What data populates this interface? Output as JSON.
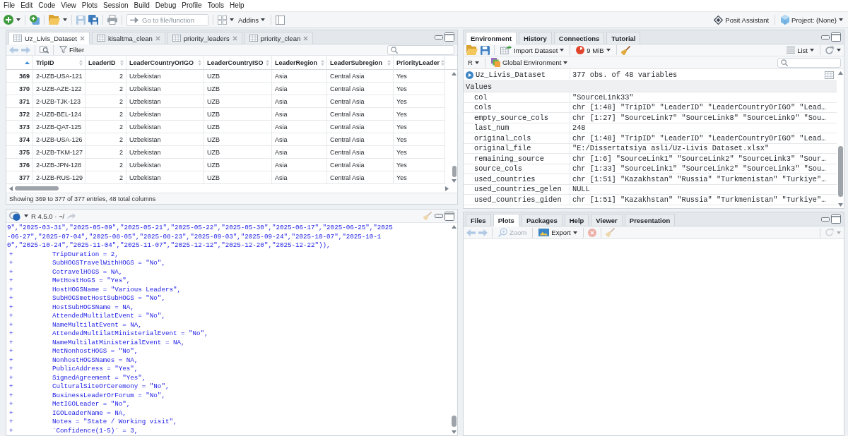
{
  "menu_bar": [
    "File",
    "Edit",
    "Code",
    "View",
    "Plots",
    "Session",
    "Build",
    "Debug",
    "Profile",
    "Tools",
    "Help"
  ],
  "toolbar": {
    "actions": [
      {
        "kind": "new_file",
        "disabled": false
      },
      {
        "kind": "new_project",
        "disabled": false
      },
      {
        "kind": "open",
        "disabled": false
      },
      {
        "kind": "save",
        "disabled": true
      },
      {
        "kind": "save_all",
        "disabled": false
      },
      {
        "kind": "print",
        "disabled": false
      }
    ],
    "goto": {
      "placeholder": "Go to file/function"
    },
    "tools": [
      {
        "kind": "layout",
        "disabled": false
      },
      {
        "kind": "addins",
        "label": "Addins",
        "disabled": false
      },
      {
        "kind": "panel",
        "disabled": false
      }
    ],
    "assistant": "Posit Assistant",
    "project": "Project: (None)"
  },
  "source_pane": {
    "tabs": [
      {
        "label": "Uz_Livis_Dataset",
        "selected": true
      },
      {
        "label": "kisaltma_clean",
        "selected": false
      },
      {
        "label": "priority_leaders",
        "selected": false
      },
      {
        "label": "priority_clean",
        "selected": false
      }
    ],
    "actions": [
      {
        "kind": "back",
        "disabled": true
      },
      {
        "kind": "forward",
        "disabled": true
      },
      {
        "kind": "popout",
        "disabled": false
      },
      {
        "kind": "filter",
        "label": "Filter",
        "disabled": false
      }
    ],
    "table": {
      "index_sorted": true,
      "columns": [
        {
          "label": "TripID",
          "kind": "text"
        },
        {
          "label": "LeaderID",
          "kind": "numeric"
        },
        {
          "label": "LeaderCountryOrIGO",
          "kind": "text"
        },
        {
          "label": "LeaderCountryISO",
          "kind": "text"
        },
        {
          "label": "LeaderRegion",
          "kind": "text"
        },
        {
          "label": "LeaderSubregion",
          "kind": "text"
        },
        {
          "label": "PriorityLeader",
          "kind": "text"
        }
      ],
      "rows": [
        {
          "index": "369",
          "cells": [
            "2-UZB-USA-121",
            "2",
            "Uzbekistan",
            "UZB",
            "Asia",
            "Central Asia",
            "Yes"
          ]
        },
        {
          "index": "370",
          "cells": [
            "2-UZB-AZE-122",
            "2",
            "Uzbekistan",
            "UZB",
            "Asia",
            "Central Asia",
            "Yes"
          ]
        },
        {
          "index": "371",
          "cells": [
            "2-UZB-TJK-123",
            "2",
            "Uzbekistan",
            "UZB",
            "Asia",
            "Central Asia",
            "Yes"
          ]
        },
        {
          "index": "372",
          "cells": [
            "2-UZB-BEL-124",
            "2",
            "Uzbekistan",
            "UZB",
            "Asia",
            "Central Asia",
            "Yes"
          ]
        },
        {
          "index": "373",
          "cells": [
            "2-UZB-QAT-125",
            "2",
            "Uzbekistan",
            "UZB",
            "Asia",
            "Central Asia",
            "Yes"
          ]
        },
        {
          "index": "374",
          "cells": [
            "2-UZB-USA-126",
            "2",
            "Uzbekistan",
            "UZB",
            "Asia",
            "Central Asia",
            "Yes"
          ]
        },
        {
          "index": "375",
          "cells": [
            "2-UZB-TKM-127",
            "2",
            "Uzbekistan",
            "UZB",
            "Asia",
            "Central Asia",
            "Yes"
          ]
        },
        {
          "index": "376",
          "cells": [
            "2-UZB-JPN-128",
            "2",
            "Uzbekistan",
            "UZB",
            "Asia",
            "Central Asia",
            "Yes"
          ]
        },
        {
          "index": "377",
          "cells": [
            "2-UZB-RUS-129",
            "2",
            "Uzbekistan",
            "UZB",
            "Asia",
            "Central Asia",
            "Yes"
          ]
        }
      ]
    },
    "status": "Showing 369 to 377 of 377 entries, 48 total columns"
  },
  "console": {
    "title": "R 4.5.0 · ~/",
    "lines": [
      {
        "text": "9\",\"2025-03-31\",\"2025-05-09\",\"2025-05-21\",\"2025-05-22\",\"2025-05-30\",\"2025-06-17\",\"2025-06-25\",\"2025"
      },
      {
        "text": "-06-27\",\"2025-07-04\",\"2025-08-05\",\"2025-08-23\",\"2025-09-03\",\"2025-09-24\",\"2025-10-07\",\"2025-10-1"
      },
      {
        "text": "0\",\"2025-10-24\",\"2025-11-04\",\"2025-11-07\",\"2025-12-12\",\"2025-12-20\",\"2025-12-22\")),"
      },
      {
        "prompt": "+",
        "text": "TripDuration = 2,"
      },
      {
        "prompt": "+",
        "text": "SubHOGSTravelWithHOGS = \"No\","
      },
      {
        "prompt": "+",
        "text": "CotravelHOGS = NA,"
      },
      {
        "prompt": "+",
        "text": "MetHostHoGS = \"Yes\","
      },
      {
        "prompt": "+",
        "text": "HostHOGSName = \"Various Leaders\","
      },
      {
        "prompt": "+",
        "text": "SubHOGSmetHostSubHOGS = \"No\","
      },
      {
        "prompt": "+",
        "text": "HostSubHOGSName = NA,"
      },
      {
        "prompt": "+",
        "text": "AttendedMultilatEvent = \"No\","
      },
      {
        "prompt": "+",
        "text": "NameMultilatEvent = NA,"
      },
      {
        "prompt": "+",
        "text": "AttendedMultilatMinisterialEvent = \"No\","
      },
      {
        "prompt": "+",
        "text": "NameMultilatMinisterialEvent = NA,"
      },
      {
        "prompt": "+",
        "text": "MetNonhostHOGS = \"No\","
      },
      {
        "prompt": "+",
        "text": "NonhostHOGSNames = NA,"
      },
      {
        "prompt": "+",
        "text": "PublicAddress = \"Yes\","
      },
      {
        "prompt": "+",
        "text": "SignedAgreement = \"Yes\","
      },
      {
        "prompt": "+",
        "text": "CulturalSiteOrCeremony = \"No\","
      },
      {
        "prompt": "+",
        "text": "BusinessLeaderOrForum = \"No\","
      },
      {
        "prompt": "+",
        "text": "MetIGOLeader = \"No\","
      },
      {
        "prompt": "+",
        "text": "IGOLeaderName = NA,"
      },
      {
        "prompt": "+",
        "text": "Notes = \"State / Working visit\","
      },
      {
        "prompt": "+",
        "text": "`Confidence(1-5)` = 3,"
      }
    ]
  },
  "environment_pane": {
    "tabs": [
      {
        "label": "Environment",
        "selected": true
      },
      {
        "label": "History",
        "selected": false
      },
      {
        "label": "Connections",
        "selected": false
      },
      {
        "label": "Tutorial",
        "selected": false
      }
    ],
    "actions": [
      {
        "kind": "load",
        "disabled": false
      },
      {
        "kind": "save_workspace",
        "disabled": false
      },
      {
        "kind": "import",
        "label": "Import Dataset",
        "disabled": false
      },
      {
        "kind": "memory",
        "label": "9 MiB",
        "disabled": false
      },
      {
        "kind": "clear",
        "disabled": false
      }
    ],
    "right_actions": [
      {
        "kind": "view",
        "label": "List",
        "disabled": false
      },
      {
        "kind": "refresh",
        "disabled": false
      }
    ],
    "language": "R",
    "scope": "Global Environment",
    "data": [
      {
        "name": "Uz_Livis_Dataset",
        "value": "377 obs. of 48 variables"
      }
    ],
    "values_header": "Values",
    "values": [
      {
        "name": "col",
        "value": "\"SourceLink33\""
      },
      {
        "name": "cols",
        "value": "chr [1:48] \"TripID\" \"LeaderID\" \"LeaderCountryOrIGO\" \"Lead…"
      },
      {
        "name": "empty_source_cols",
        "value": "chr [1:27] \"SourceLink7\" \"SourceLink8\" \"SourceLink9\" \"Sou…"
      },
      {
        "name": "last_num",
        "value": "248"
      },
      {
        "name": "original_cols",
        "value": "chr [1:48] \"TripID\" \"LeaderID\" \"LeaderCountryOrIGO\" \"Lead…"
      },
      {
        "name": "original_file",
        "value": "\"E:/Dissertatsiya asli/Uz-Livis Dataset.xlsx\""
      },
      {
        "name": "remaining_source",
        "value": "chr [1:6] \"SourceLink1\" \"SourceLink2\" \"SourceLink3\" \"Sour…"
      },
      {
        "name": "source_cols",
        "value": "chr [1:33] \"SourceLink1\" \"SourceLink2\" \"SourceLink3\" \"Sou…"
      },
      {
        "name": "used_countries",
        "value": "chr [1:51] \"Kazakhstan\" \"Russia\" \"Turkmenistan\" \"Turkiye\"…"
      },
      {
        "name": "used_countries_gelen",
        "value": "NULL"
      },
      {
        "name": "used_countries_giden",
        "value": "chr [1:51] \"Kazakhstan\" \"Russia\" \"Turkmenistan\" \"Turkiye\"…"
      }
    ]
  },
  "files_pane": {
    "tabs": [
      {
        "label": "Files",
        "selected": false
      },
      {
        "label": "Plots",
        "selected": true
      },
      {
        "label": "Packages",
        "selected": false
      },
      {
        "label": "Help",
        "selected": false
      },
      {
        "label": "Viewer",
        "selected": false
      },
      {
        "label": "Presentation",
        "selected": false
      }
    ],
    "actions": [
      {
        "kind": "back",
        "disabled": true
      },
      {
        "kind": "forward",
        "disabled": true
      },
      {
        "kind": "zoom",
        "label": "Zoom",
        "disabled": true
      },
      {
        "kind": "export",
        "label": "Export",
        "disabled": false
      },
      {
        "kind": "remove",
        "disabled": true
      },
      {
        "kind": "clear",
        "disabled": true
      }
    ],
    "right_actions": [
      {
        "kind": "refresh",
        "disabled": true
      }
    ]
  }
}
